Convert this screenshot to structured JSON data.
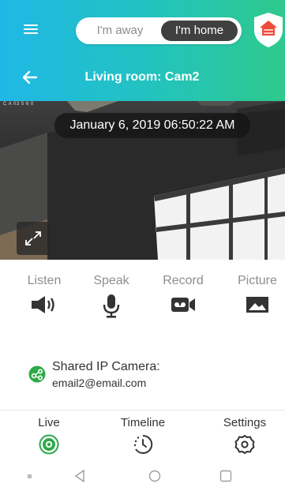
{
  "colors": {
    "header_gradient_start": "#1fb8e6",
    "header_gradient_end": "#2ec98c",
    "toggle_active_bg": "#404040",
    "live_accent": "#2eaa4a",
    "shield_red": "#ef4a3a"
  },
  "header": {
    "menu_icon": "hamburger-menu-icon",
    "mode_toggle": {
      "away_label": "I'm away",
      "home_label": "I'm home",
      "selected": "I'm home"
    },
    "shield_icon": "home-shield-icon",
    "back_icon": "arrow-back-icon",
    "title": "Living room: Cam2"
  },
  "video": {
    "camera_tag": "C A 03 5 6 0",
    "timestamp": "January 6, 2019 06:50:22 AM",
    "fullscreen_icon": "expand-arrows-icon"
  },
  "actions": [
    {
      "label": "Listen",
      "icon": "speaker-icon"
    },
    {
      "label": "Speak",
      "icon": "microphone-icon"
    },
    {
      "label": "Record",
      "icon": "video-record-icon"
    },
    {
      "label": "Picture",
      "icon": "picture-icon"
    }
  ],
  "shared": {
    "icon": "share-icon",
    "title": "Shared IP Camera:",
    "email": "email2@email.com"
  },
  "bottom_nav": [
    {
      "label": "Live",
      "icon": "live-camera-icon",
      "active": true
    },
    {
      "label": "Timeline",
      "icon": "timeline-clock-icon",
      "active": false
    },
    {
      "label": "Settings",
      "icon": "gear-icon",
      "active": false
    }
  ],
  "system_nav": {
    "recents_icon": "recents-square-small-icon",
    "back_icon": "triangle-back-icon",
    "home_icon": "circle-home-icon",
    "overview_icon": "square-overview-icon"
  }
}
